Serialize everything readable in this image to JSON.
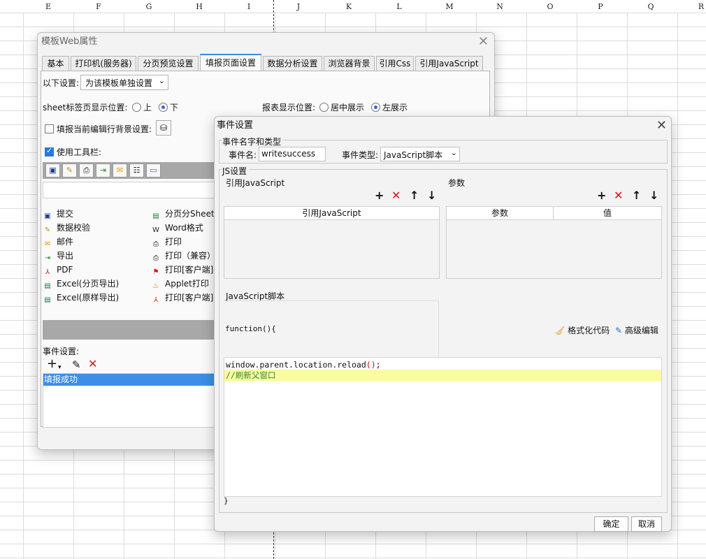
{
  "sheet": {
    "columns": [
      "E",
      "F",
      "G",
      "H",
      "I",
      "J",
      "K",
      "L",
      "M",
      "N",
      "O",
      "P",
      "Q",
      "R"
    ]
  },
  "web_dialog": {
    "title": "模板Web属性",
    "tabs": [
      {
        "label": "基本"
      },
      {
        "label": "打印机(服务器)"
      },
      {
        "label": "分页预览设置"
      },
      {
        "label": "填报页面设置"
      },
      {
        "label": "数据分析设置"
      },
      {
        "label": "浏览器背景"
      },
      {
        "label": "引用Css"
      },
      {
        "label": "引用JavaScript"
      }
    ],
    "setting_label": "以下设置:",
    "setting_value": "为该模板单独设置",
    "sheet_pos_label": "sheet标签页显示位置:",
    "opt_top": "上",
    "opt_bottom": "下",
    "report_pos_label": "报表显示位置:",
    "opt_center": "居中展示",
    "opt_left": "左展示",
    "bg_label": "填报当前编辑行背景设置:",
    "toolbar_label": "使用工具栏:",
    "items_left": [
      "提交",
      "数据校验",
      "邮件",
      "导出",
      "PDF",
      "Excel(分页导出)",
      "Excel(原样导出)"
    ],
    "items_right": [
      "分页分Sheet导",
      "Word格式",
      "打印",
      "打印（兼容）",
      "打印[客户端]",
      "Applet打印",
      "打印[客户端]"
    ],
    "event_label": "事件设置:",
    "event_selected": "填报成功"
  },
  "event_dialog": {
    "title": "事件设置",
    "group_name_type": "事件名字和类型",
    "event_name_label": "事件名:",
    "event_name_value": "writesuccess",
    "event_type_label": "事件类型:",
    "event_type_value": "JavaScript脚本",
    "group_js": "JS设置",
    "ref_js_label": "引用JavaScript",
    "params_label": "参数",
    "ref_js_col": "引用JavaScript",
    "param_col": "参数",
    "value_col": "值",
    "js_script_label": "JavaScript脚本",
    "func_open": "function(){",
    "format_code": "格式化代码",
    "advanced_edit": "高级编辑",
    "code_line1": "window.parent.location.reload",
    "code_line1_paren": "()",
    "code_line1_end": ";",
    "code_line2": "//刷新父窗口",
    "func_close": "}",
    "ok": "确定",
    "cancel": "取消"
  }
}
